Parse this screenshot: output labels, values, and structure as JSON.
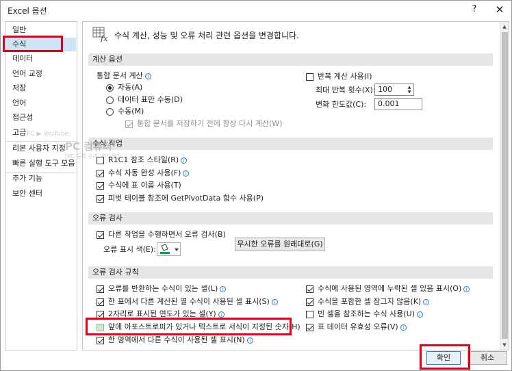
{
  "window": {
    "title": "Excel 옵션",
    "help": "?",
    "close": "✕"
  },
  "sidebar": {
    "items": [
      {
        "label": "일반"
      },
      {
        "label": "수식"
      },
      {
        "label": "데이터"
      },
      {
        "label": "언어 교정"
      },
      {
        "label": "저장"
      },
      {
        "label": "언어"
      },
      {
        "label": "접근성"
      },
      {
        "label": "고급"
      },
      {
        "label": "리본 사용자 지정"
      },
      {
        "label": "빠른 실행 도구 모음"
      },
      {
        "label": "추가 기능"
      },
      {
        "label": "보안 센터"
      }
    ],
    "active_index": 1
  },
  "header": {
    "text": "수식 계산, 성능 및 오류 처리 관련 옵션을 변경합니다."
  },
  "calc": {
    "section": "계산 옵션",
    "workbook_calc": "통합 문서 계산",
    "auto": "자동(A)",
    "auto_except": "데이터 표만 수동(D)",
    "manual": "수동(M)",
    "recalc_before_save": "통합 문서를 저장하기 전에 항상 다시 계산(W)",
    "iterative": "반복 계산 사용(I)",
    "max_iter_label": "최대 반복 횟수(X):",
    "max_iter_value": "100",
    "max_change_label": "변화 한도값(C):",
    "max_change_value": "0.001"
  },
  "formulas": {
    "section": "수식 작업",
    "r1c1": "R1C1 참조 스타일(R)",
    "autocomplete": "수식 자동 완성 사용(F)",
    "table_names": "수식에 표 이름 사용(T)",
    "getpivotdata": "피벗 테이블 참조에 GetPivotData 함수 사용(P)"
  },
  "error_check": {
    "section": "오류 검사",
    "enable_bg": "다른 작업을 수행하면서 오류 검사(B)",
    "color_label": "오류 표시 색(E):",
    "reset_button": "무시한 오류를 원래대로(G)"
  },
  "rules": {
    "section": "오류 검사 규칙",
    "left": [
      {
        "label": "오류를 반환하는 수식이 있는 셀(L)",
        "checked": true
      },
      {
        "label": "한 표에서 다른 계산된 열 수식이 사용된 셀 표시(S)",
        "checked": true
      },
      {
        "label": "2자리로 표시된 연도가 있는 셀(Y)",
        "checked": true
      },
      {
        "label": "앞에 아포스트로피가 있거나 텍스트로 서식이 지정된 숫자(H)",
        "checked": false
      },
      {
        "label": "한 영역에서 다른 수식이 사용된 셀 표시(N)",
        "checked": true
      }
    ],
    "right": [
      {
        "label": "수식에 사용된 영역에 누락된 셀 있음 표시(O)",
        "checked": true
      },
      {
        "label": "수식을 포함한 셀 잠그지 않음(K)",
        "checked": true
      },
      {
        "label": "빈 셀을 참조하는 수식 사용(U)",
        "checked": false
      },
      {
        "label": "표 데이터 유효성 오류(V)",
        "checked": true
      }
    ]
  },
  "footer": {
    "ok": "확인",
    "cancel": "취소"
  },
  "watermark": {
    "badge": "PC ▶ YouTube",
    "title": "PC 컴퓨터",
    "sub": "[PC 문화 수리, 윈도우]"
  },
  "colors": {
    "highlight_red": "#e0001b",
    "active_nav": "#cde6f7",
    "error_color": "#00a651"
  },
  "icons": {
    "info": "i",
    "up": "▲",
    "down": "▼"
  }
}
